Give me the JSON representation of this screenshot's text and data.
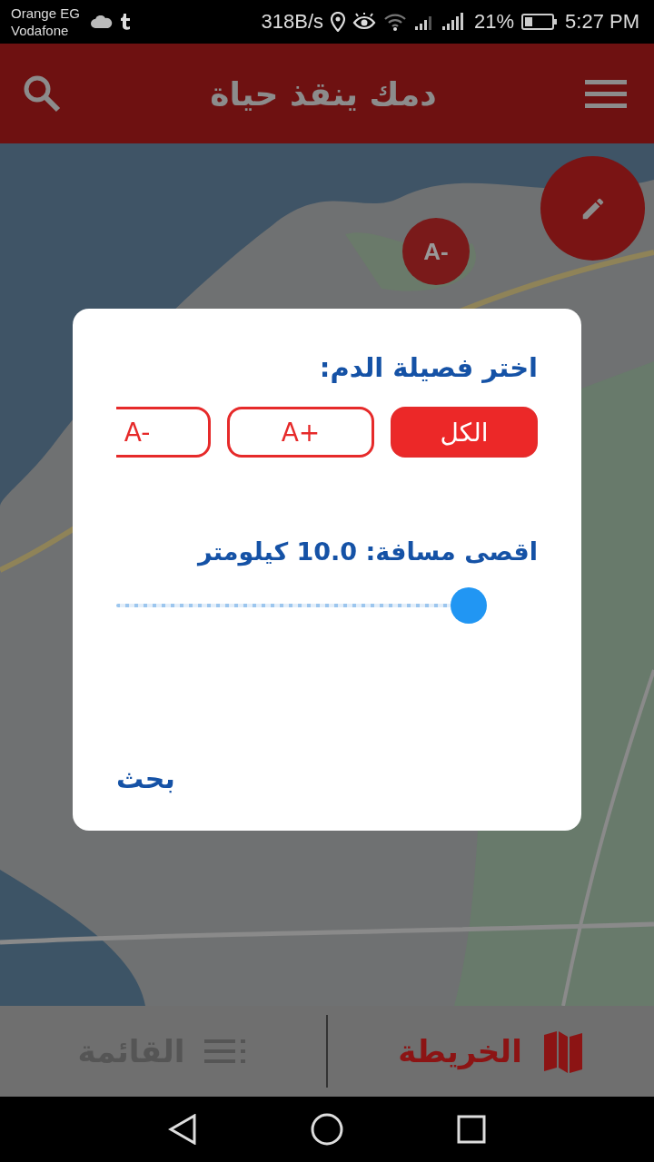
{
  "status_bar": {
    "carriers": [
      "Orange EG",
      "Vodafone"
    ],
    "speed": "318B/s",
    "battery": "21%",
    "time": "5:27 PM"
  },
  "header": {
    "title": "دمك ينقذ حياة"
  },
  "map": {
    "markers": [
      {
        "label": "A-"
      }
    ]
  },
  "dialog": {
    "blood_label": "اختر فصيلة الدم:",
    "blood_types": [
      {
        "label": "الكل",
        "selected": true
      },
      {
        "label": "A+",
        "selected": false
      },
      {
        "label": "A-",
        "selected": false
      }
    ],
    "distance_label": "اقصى مسافة: 10.0 كيلومتر",
    "distance": {
      "level": 1.0
    },
    "search_button": "بحث"
  },
  "bottom_nav": [
    {
      "label": "الخريطة",
      "kind": "map",
      "selected": true
    },
    {
      "label": "القائمة",
      "kind": "list",
      "selected": false
    }
  ]
}
